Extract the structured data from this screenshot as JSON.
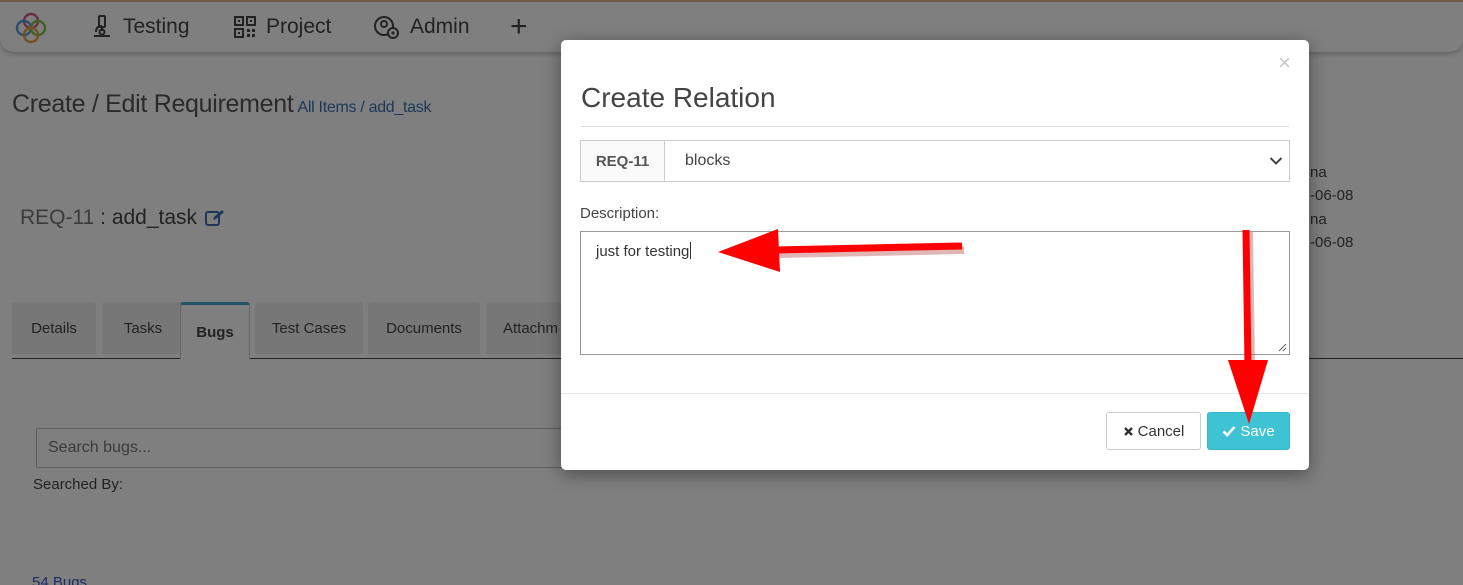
{
  "nav": {
    "items": [
      {
        "label": "Testing",
        "icon": "microscope-icon"
      },
      {
        "label": "Project",
        "icon": "qr-code-icon"
      },
      {
        "label": "Admin",
        "icon": "user-gear-icon"
      }
    ],
    "plus_icon": "plus-icon"
  },
  "page": {
    "title": "Create / Edit Requirement",
    "breadcrumb": "All Items / add_task",
    "req_id": "REQ-11",
    "req_separator": " : ",
    "req_name": "add_task",
    "side_info": [
      "na",
      "-06-08",
      "na",
      "-06-08"
    ]
  },
  "tabs": [
    {
      "label": "Details",
      "active": false
    },
    {
      "label": "Tasks",
      "active": false
    },
    {
      "label": "Bugs",
      "active": true
    },
    {
      "label": "Test Cases",
      "active": false
    },
    {
      "label": "Documents",
      "active": false
    },
    {
      "label": "Attachm",
      "active": false
    }
  ],
  "bugs": {
    "search_placeholder": "Search bugs...",
    "searched_by": "Searched By:",
    "count_link": "54 Bugs"
  },
  "modal": {
    "title": "Create Relation",
    "close_symbol": "×",
    "req_addon": "REQ-11",
    "relation_selected": "blocks",
    "description_label": "Description:",
    "description_value": "just for testing",
    "cancel_label": "Cancel",
    "save_label": "Save"
  },
  "colors": {
    "accent": "#3ec3d5",
    "active_tab_border": "#3fa9c6",
    "link": "#3a6fb0",
    "annotation_arrow": "#ff0000"
  }
}
